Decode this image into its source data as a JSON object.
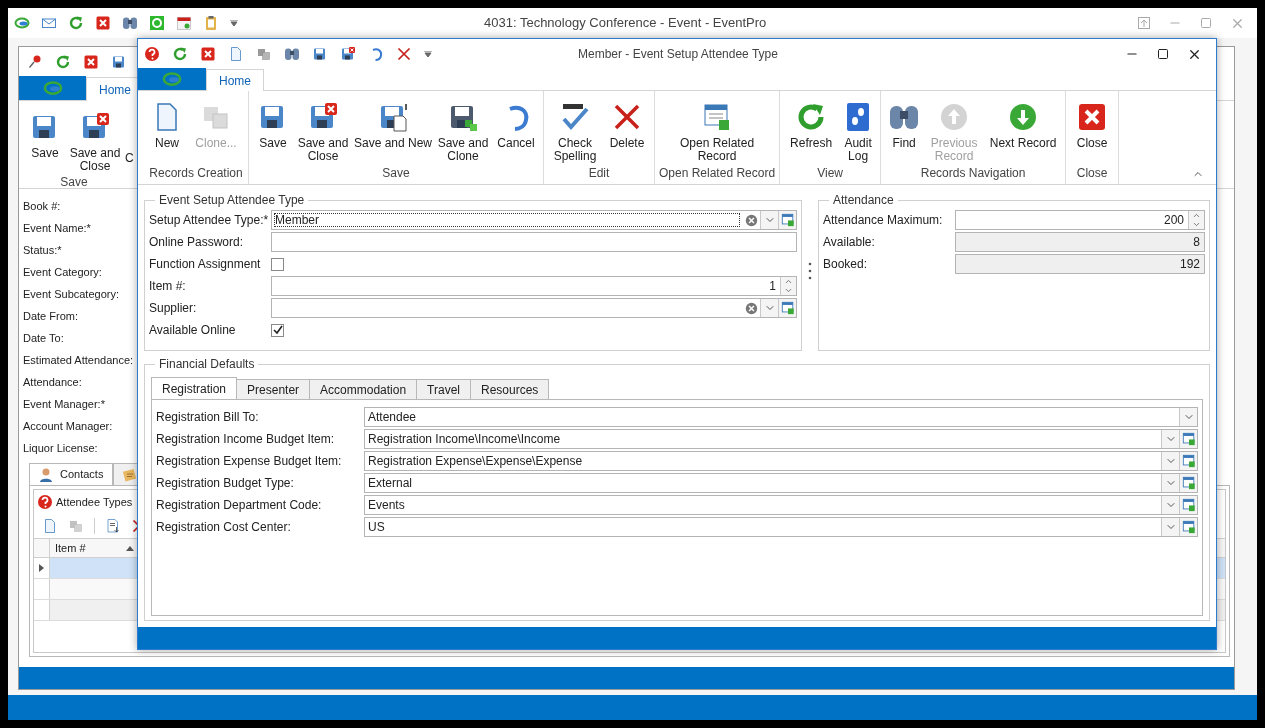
{
  "app_window": {
    "title": "4031: Technology Conference - Event - EventPro"
  },
  "back_window": {
    "tab": "Home",
    "buttons": [
      {
        "label": "Save",
        "kind": "save"
      },
      {
        "label": "Save and Close",
        "kind": "save-close"
      }
    ],
    "group_label": "Save",
    "cut_button": "C",
    "fields": [
      "Book #:",
      "Event Name:*",
      "Status:*",
      "Event Category:",
      "Event Subcategory:",
      "Date From:",
      "Date To:",
      "Estimated Attendance:",
      "Attendance:",
      "Event Manager:*",
      "Account Manager:",
      "Liquor License:"
    ],
    "tabs": [
      {
        "label": "Contacts",
        "kind": "person",
        "selected": true
      },
      {
        "kind": "note",
        "selected": false
      }
    ],
    "panel_title": "Attendee Types",
    "grid": {
      "columns": [
        "Item #"
      ],
      "rows": [
        {
          "selected": true
        },
        {
          "selected": false
        },
        {
          "selected": false
        }
      ]
    }
  },
  "dialog": {
    "title": "Member - Event Setup Attendee Type",
    "tab": "Home",
    "ribbon_groups": [
      {
        "label": "Records Creation",
        "buttons": [
          {
            "label": "New",
            "kind": "new",
            "disabled": false
          },
          {
            "label": "Clone...",
            "kind": "clone",
            "disabled": true
          }
        ]
      },
      {
        "label": "Save",
        "buttons": [
          {
            "label": "Save",
            "kind": "save",
            "disabled": false
          },
          {
            "label": "Save and Close",
            "kind": "save-close",
            "disabled": false
          },
          {
            "label": "Save and New",
            "kind": "save-new",
            "disabled": false
          },
          {
            "label": "Save and Clone",
            "kind": "save-clone",
            "disabled": false
          },
          {
            "label": "Cancel",
            "kind": "cancel",
            "disabled": false
          }
        ]
      },
      {
        "label": "Edit",
        "buttons": [
          {
            "label": "Check Spelling",
            "kind": "spell",
            "disabled": false
          },
          {
            "label": "Delete",
            "kind": "delete",
            "disabled": false
          }
        ]
      },
      {
        "label": "Open Related Record",
        "buttons": [
          {
            "label": "Open Related Record",
            "kind": "related",
            "disabled": false
          }
        ]
      },
      {
        "label": "View",
        "buttons": [
          {
            "label": "Refresh",
            "kind": "refresh",
            "disabled": false
          },
          {
            "label": "Audit Log",
            "kind": "audit",
            "disabled": false
          }
        ]
      },
      {
        "label": "Records Navigation",
        "buttons": [
          {
            "label": "Find",
            "kind": "find",
            "disabled": false
          },
          {
            "label": "Previous Record",
            "kind": "prev",
            "disabled": true
          },
          {
            "label": "Next Record",
            "kind": "next",
            "disabled": false
          }
        ]
      },
      {
        "label": "Close",
        "buttons": [
          {
            "label": "Close",
            "kind": "close",
            "disabled": false
          }
        ]
      }
    ],
    "setup": {
      "title": "Event Setup Attendee Type",
      "fields": [
        {
          "kind": "lookup",
          "label": "Setup Attendee Type:*",
          "value": "Member",
          "focused": true
        },
        {
          "kind": "text",
          "label": "Online Password:"
        },
        {
          "kind": "checkbox",
          "label": "Function Assignment",
          "checked": false
        },
        {
          "kind": "spin",
          "label": "Item #:",
          "value": "1"
        },
        {
          "kind": "lookup",
          "label": "Supplier:",
          "focused": false
        },
        {
          "kind": "checkbox",
          "label": "Available Online",
          "checked": true
        }
      ]
    },
    "attendance": {
      "title": "Attendance",
      "fields": [
        {
          "kind": "spin",
          "label": "Attendance Maximum:",
          "value": "200"
        },
        {
          "kind": "readonly",
          "label": "Available:",
          "value": "8"
        },
        {
          "kind": "readonly",
          "label": "Booked:",
          "value": "192"
        }
      ]
    },
    "financial": {
      "title": "Financial Defaults",
      "tabs": [
        {
          "label": "Registration",
          "selected": true
        },
        {
          "label": "Presenter",
          "selected": false
        },
        {
          "label": "Accommodation",
          "selected": false
        },
        {
          "label": "Travel",
          "selected": false
        },
        {
          "label": "Resources",
          "selected": false
        }
      ],
      "fields": [
        {
          "kind": "dropdown",
          "label": "Registration Bill To:",
          "value": "Attendee"
        },
        {
          "kind": "combo",
          "label": "Registration Income Budget Item:",
          "value": "Registration Income\\Income\\Income"
        },
        {
          "kind": "combo",
          "label": "Registration Expense Budget Item:",
          "value": "Registration Expense\\Expense\\Expense"
        },
        {
          "kind": "combo",
          "label": "Registration Budget Type:",
          "value": "External"
        },
        {
          "kind": "combo",
          "label": "Registration Department Code:",
          "value": "Events"
        },
        {
          "kind": "combo",
          "label": "Registration Cost Center:",
          "value": "US"
        }
      ]
    }
  }
}
